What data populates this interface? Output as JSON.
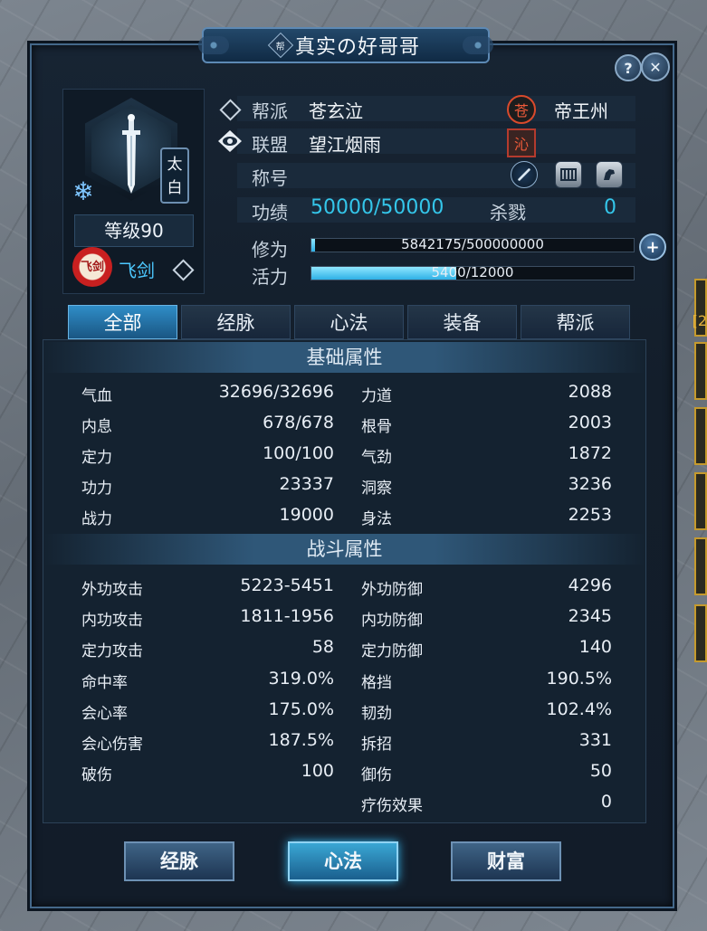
{
  "window": {
    "title": "真实の好哥哥",
    "title_icon_glyph": "帮",
    "help_glyph": "?",
    "close_glyph": "✕"
  },
  "profile": {
    "school_tag": "太白",
    "level": "等级90",
    "faction_badge": "飞剑",
    "faction_name": "飞剑"
  },
  "info": {
    "guild_label": "帮派",
    "guild_value": "苍玄泣",
    "alliance_label": "联盟",
    "alliance_value": "望江烟雨",
    "region_seal": "苍",
    "region_value": "帝王州",
    "region_seal2": "沁",
    "title_label": "称号",
    "merit_label": "功绩",
    "merit_value": "50000/50000",
    "kill_label": "杀戮",
    "kill_value": "0"
  },
  "bars": {
    "cultivation_label": "修为",
    "cultivation_text": "5842175/500000000",
    "cultivation_fraction": 0.012,
    "vigor_label": "活力",
    "vigor_text": "5400/12000",
    "vigor_fraction": 0.45
  },
  "tabs": [
    "全部",
    "经脉",
    "心法",
    "装备",
    "帮派"
  ],
  "basic": {
    "title": "基础属性",
    "left": [
      {
        "name": "气血",
        "value": "32696/32696"
      },
      {
        "name": "内息",
        "value": "678/678"
      },
      {
        "name": "定力",
        "value": "100/100"
      },
      {
        "name": "功力",
        "value": "23337"
      },
      {
        "name": "战力",
        "value": "19000"
      }
    ],
    "right": [
      {
        "name": "力道",
        "value": "2088"
      },
      {
        "name": "根骨",
        "value": "2003"
      },
      {
        "name": "气劲",
        "value": "1872"
      },
      {
        "name": "洞察",
        "value": "3236"
      },
      {
        "name": "身法",
        "value": "2253"
      }
    ]
  },
  "combat": {
    "title": "战斗属性",
    "left": [
      {
        "name": "外功攻击",
        "value": "5223-5451"
      },
      {
        "name": "内功攻击",
        "value": "1811-1956"
      },
      {
        "name": "定力攻击",
        "value": "58"
      },
      {
        "name": "命中率",
        "value": "319.0%"
      },
      {
        "name": "会心率",
        "value": "175.0%"
      },
      {
        "name": "会心伤害",
        "value": "187.5%"
      },
      {
        "name": "破伤",
        "value": "100"
      }
    ],
    "right": [
      {
        "name": "外功防御",
        "value": "4296"
      },
      {
        "name": "内功防御",
        "value": "2345"
      },
      {
        "name": "定力防御",
        "value": "140"
      },
      {
        "name": "格挡",
        "value": "190.5%"
      },
      {
        "name": "韧劲",
        "value": "102.4%"
      },
      {
        "name": "拆招",
        "value": "331"
      },
      {
        "name": "御伤",
        "value": "50"
      },
      {
        "name": "疗伤效果",
        "value": "0"
      }
    ]
  },
  "buttons": {
    "meridians": "经脉",
    "mind": "心法",
    "wealth": "财富"
  },
  "edge": {
    "bracket_text": "[2"
  },
  "colors": {
    "accent": "#34c6ea",
    "seal_red": "#ef5b3a",
    "panel_bg": "#131e2b"
  }
}
